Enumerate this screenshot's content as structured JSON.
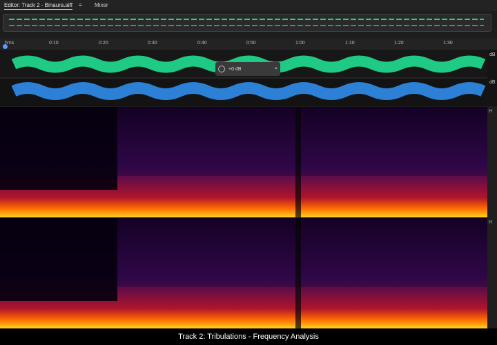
{
  "tabs": {
    "editor": "Editor: Track 2 - Binaura.aiff",
    "menu": "≡",
    "mixer": "Mixer"
  },
  "ruler": {
    "unit": "hms",
    "ticks": [
      "0:10",
      "0:20",
      "0:30",
      "0:40",
      "0:50",
      "1:00",
      "1:10",
      "1:20",
      "1:30"
    ]
  },
  "hud": {
    "gain": "+0 dB"
  },
  "channels": {
    "top_label": "dB",
    "bottom_label": "dB"
  },
  "spectrogram": {
    "top_label": "H",
    "bottom_label": "H"
  },
  "caption": "Track 2: Tribulations - Frequency Analysis",
  "colors": {
    "left_wave": "#20d48a",
    "right_wave": "#2d86e0",
    "spectrum_hot": "#ffd21f"
  }
}
